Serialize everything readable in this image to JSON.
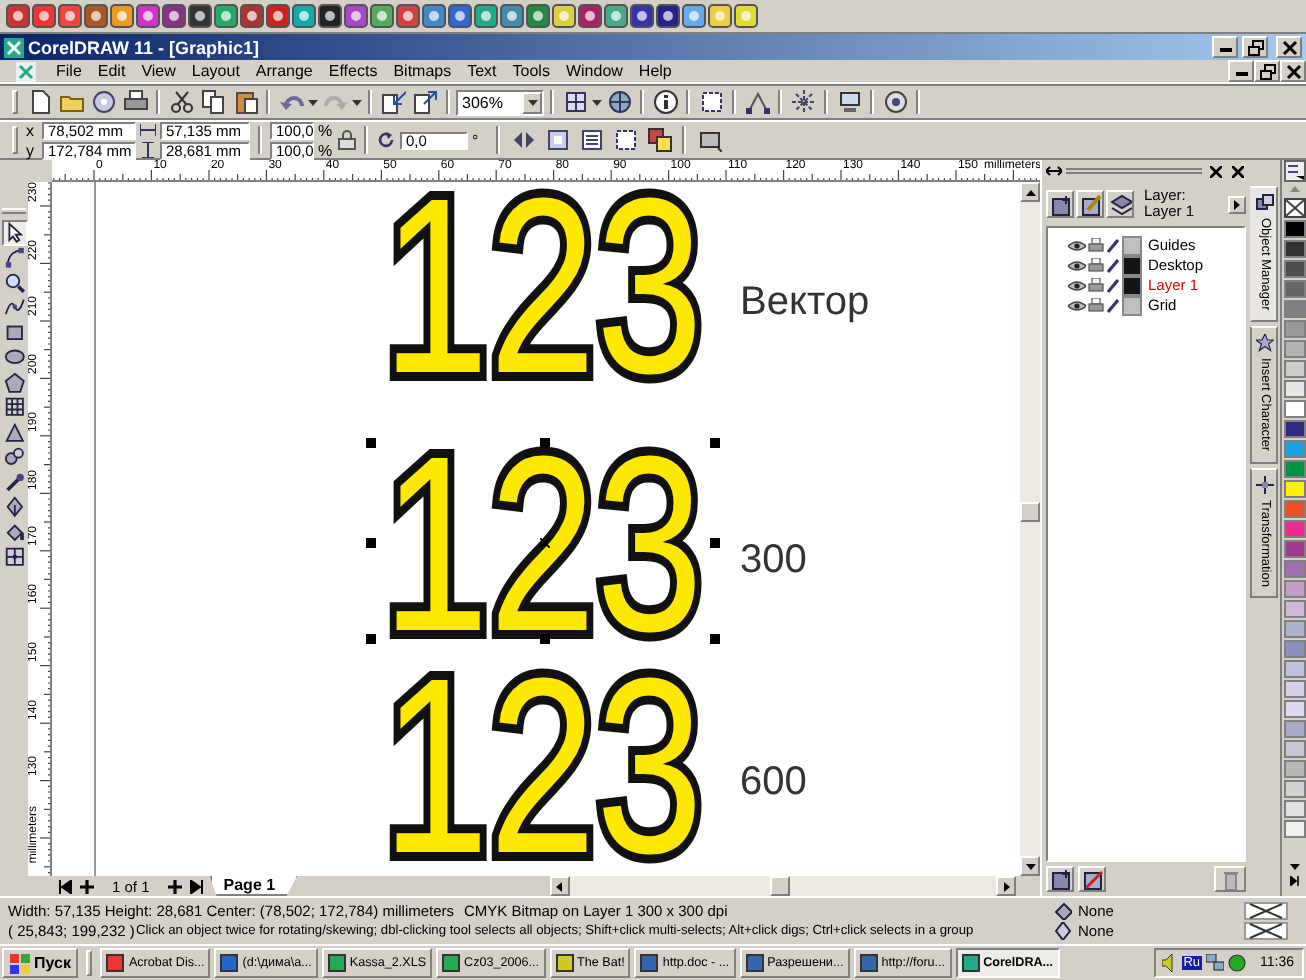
{
  "window": {
    "title": "CorelDRAW 11 - [Graphic1]"
  },
  "menu": [
    "File",
    "Edit",
    "View",
    "Layout",
    "Arrange",
    "Effects",
    "Bitmaps",
    "Text",
    "Tools",
    "Window",
    "Help"
  ],
  "toolbar": {
    "zoom": "306%"
  },
  "property_bar": {
    "position": [
      {
        "label": "x",
        "value": "78,502 mm"
      },
      {
        "label": "y",
        "value": "172,784 mm"
      }
    ],
    "size": [
      "57,135 mm",
      "28,681 mm"
    ],
    "scale": [
      {
        "value": "100,0",
        "unit": "%"
      },
      {
        "value": "100,0",
        "unit": "%"
      }
    ],
    "rotation": {
      "value": "0,0",
      "unit": "°"
    }
  },
  "rulers": {
    "horizontal": {
      "ticks": [
        "0",
        "10",
        "20",
        "30",
        "40",
        "50",
        "60",
        "70",
        "80",
        "90",
        "100",
        "110",
        "120",
        "130",
        "140",
        "150"
      ],
      "unit": "millimeters"
    },
    "vertical": {
      "ticks": [
        "230",
        "220",
        "210",
        "200",
        "190",
        "180",
        "170",
        "160",
        "150",
        "140",
        "130"
      ],
      "unit": "millimeters"
    }
  },
  "toolbox": [
    {
      "kind": "pointer",
      "selected": true
    },
    {
      "kind": "shape",
      "selected": false
    },
    {
      "kind": "zoom",
      "selected": false
    },
    {
      "kind": "freehand",
      "selected": false
    },
    {
      "kind": "rectangle",
      "selected": false
    },
    {
      "kind": "ellipse",
      "selected": false
    },
    {
      "kind": "polygon",
      "selected": false
    },
    {
      "kind": "graph",
      "selected": false
    },
    {
      "kind": "text",
      "selected": false
    },
    {
      "kind": "interactive",
      "selected": false
    },
    {
      "kind": "eyedropper",
      "selected": false
    },
    {
      "kind": "outline",
      "selected": false
    },
    {
      "kind": "fill",
      "selected": false
    },
    {
      "kind": "mesh",
      "selected": false
    }
  ],
  "canvas": {
    "objects": [
      {
        "text": "123",
        "label": "Вектор",
        "selected": false
      },
      {
        "text": "123",
        "label": "300",
        "selected": true
      },
      {
        "text": "123",
        "label": "600",
        "selected": false
      }
    ]
  },
  "page_nav": {
    "counter": "1 of 1",
    "tabs": [
      {
        "label": "Page 1",
        "selected": true
      }
    ]
  },
  "docker": {
    "caption": "Layer:",
    "current": "Layer 1",
    "layers": [
      {
        "name": "Guides",
        "color": "#c0c0c0",
        "selected": false
      },
      {
        "name": "Desktop",
        "color": "#141414",
        "selected": false
      },
      {
        "name": "Layer 1",
        "color": "#141414",
        "selected": true
      },
      {
        "name": "Grid",
        "color": "#c0c0c0",
        "selected": false
      }
    ],
    "tabs": [
      {
        "label": "Object Manager",
        "selected": true
      },
      {
        "label": "Insert Character",
        "selected": false
      },
      {
        "label": "Transformation",
        "selected": false
      }
    ]
  },
  "palette": [
    {
      "kind": "none"
    },
    {
      "kind": "color",
      "color": "#000000"
    },
    {
      "kind": "color",
      "color": "#333333"
    },
    {
      "kind": "color",
      "color": "#4d4d4d"
    },
    {
      "kind": "color",
      "color": "#666666"
    },
    {
      "kind": "color",
      "color": "#808080"
    },
    {
      "kind": "color",
      "color": "#999999"
    },
    {
      "kind": "color",
      "color": "#b3b3b3"
    },
    {
      "kind": "color",
      "color": "#cccccc"
    },
    {
      "kind": "color",
      "color": "#e6e6e6"
    },
    {
      "kind": "color",
      "color": "#ffffff"
    },
    {
      "kind": "color",
      "color": "#2e2a7d"
    },
    {
      "kind": "color",
      "color": "#1ba1e2"
    },
    {
      "kind": "color",
      "color": "#009245"
    },
    {
      "kind": "color",
      "color": "#fff200"
    },
    {
      "kind": "color",
      "color": "#f04e23"
    },
    {
      "kind": "color",
      "color": "#ec2a8f"
    },
    {
      "kind": "color",
      "color": "#9e3c8e"
    },
    {
      "kind": "color",
      "color": "#a070b0"
    },
    {
      "kind": "color",
      "color": "#c0a0c8"
    },
    {
      "kind": "color",
      "color": "#d0b8d8"
    },
    {
      "kind": "color",
      "color": "#b0b0d0"
    },
    {
      "kind": "color",
      "color": "#9090c0"
    },
    {
      "kind": "color",
      "color": "#c0c0e0"
    },
    {
      "kind": "color",
      "color": "#d8d0e8"
    },
    {
      "kind": "color",
      "color": "#e0d8f0"
    },
    {
      "kind": "color",
      "color": "#a8a8c8"
    },
    {
      "kind": "color",
      "color": "#c8c8d8"
    },
    {
      "kind": "color",
      "color": "#b8b8b8"
    },
    {
      "kind": "color",
      "color": "#d0d0d0"
    },
    {
      "kind": "color",
      "color": "#e0e0e0"
    },
    {
      "kind": "color",
      "color": "#f0f0f0"
    }
  ],
  "status_bar": {
    "selection": "Width: 57,135  Height: 28,681  Center: (78,502; 172,784)  millimeters",
    "object_info": "CMYK Bitmap on Layer 1 300 x 300 dpi",
    "cursor": "( 25,843; 199,232 )",
    "hint": "Click an object twice for rotating/skewing; dbl-clicking tool selects all objects; Shift+click multi-selects; Alt+click digs; Ctrl+click selects in a group",
    "fill": "None",
    "outline": "None"
  },
  "taskbar": {
    "start": "Пуск",
    "tasks": [
      {
        "label": "Acrobat Dis...",
        "selected": false
      },
      {
        "label": "(d:\\дима\\а...",
        "selected": false
      },
      {
        "label": "Kassa_2.XLS",
        "selected": false
      },
      {
        "label": "Cz03_2006...",
        "selected": false
      },
      {
        "label": "The Bat!",
        "selected": false
      },
      {
        "label": "http.doc - ...",
        "selected": false
      },
      {
        "label": "Разрешени...",
        "selected": false
      },
      {
        "label": "http://foru...",
        "selected": false
      },
      {
        "label": "CorelDRA...",
        "selected": true
      }
    ],
    "language": "Ru",
    "clock": "11:36"
  }
}
